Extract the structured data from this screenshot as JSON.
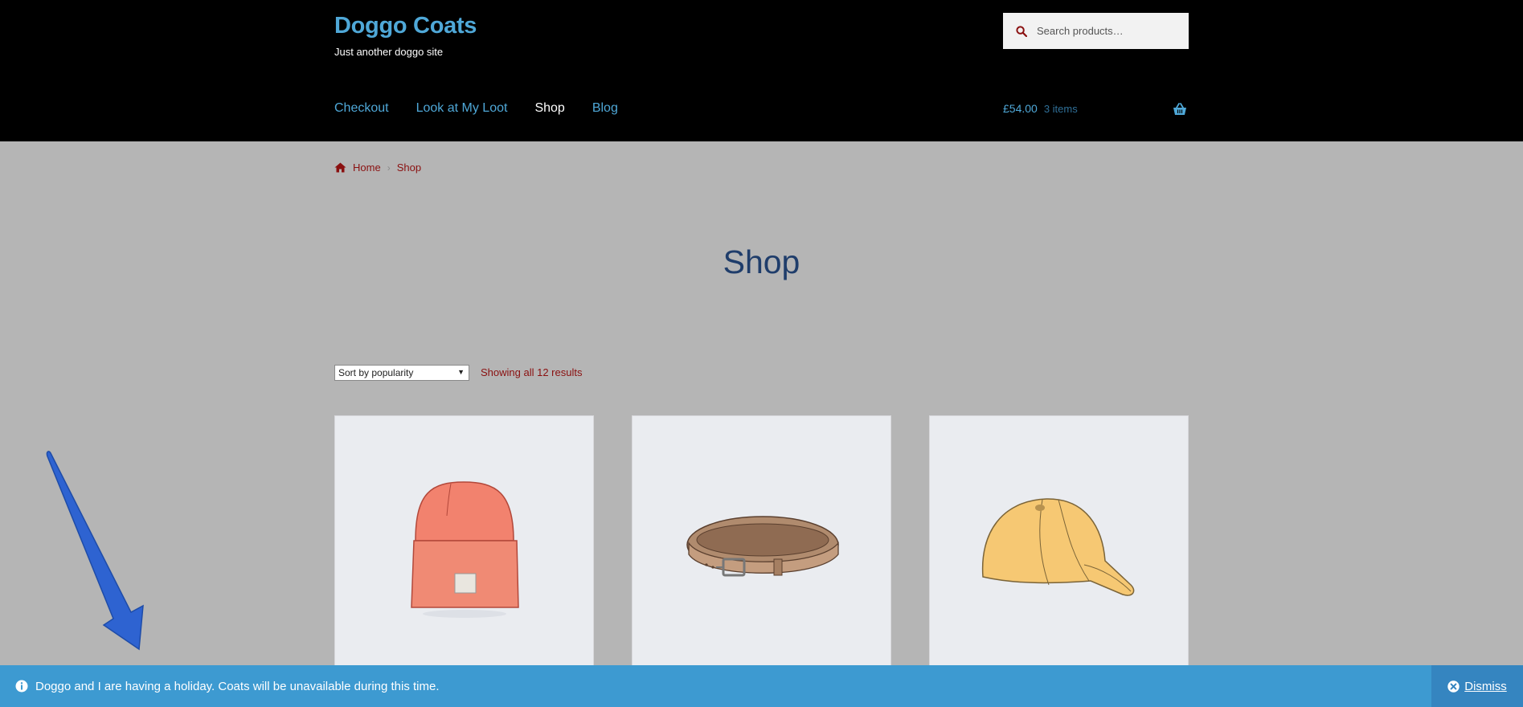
{
  "header": {
    "site_title": "Doggo Coats",
    "site_description": "Just another doggo site",
    "search_placeholder": "Search products…",
    "nav": [
      {
        "label": "Checkout"
      },
      {
        "label": "Look at My Loot"
      },
      {
        "label": "Shop",
        "active": true
      },
      {
        "label": "Blog"
      }
    ],
    "cart": {
      "total": "£54.00",
      "count": "3 items"
    }
  },
  "breadcrumb": {
    "home": "Home",
    "current": "Shop"
  },
  "page": {
    "title": "Shop"
  },
  "sorting": {
    "selected": "Sort by popularity",
    "result_count": "Showing all 12 results"
  },
  "products": [
    {
      "image": "beanie"
    },
    {
      "image": "belt"
    },
    {
      "image": "cap"
    }
  ],
  "notice": {
    "text": "Doggo and I are having a holiday. Coats will be unavailable during this time.",
    "dismiss": "Dismiss"
  },
  "colors": {
    "header_bg": "#000000",
    "link_blue": "#4fa8d8",
    "content_bg": "#b5b5b5",
    "accent_red": "#8a1010",
    "notice_bg": "#3d9ad1"
  }
}
